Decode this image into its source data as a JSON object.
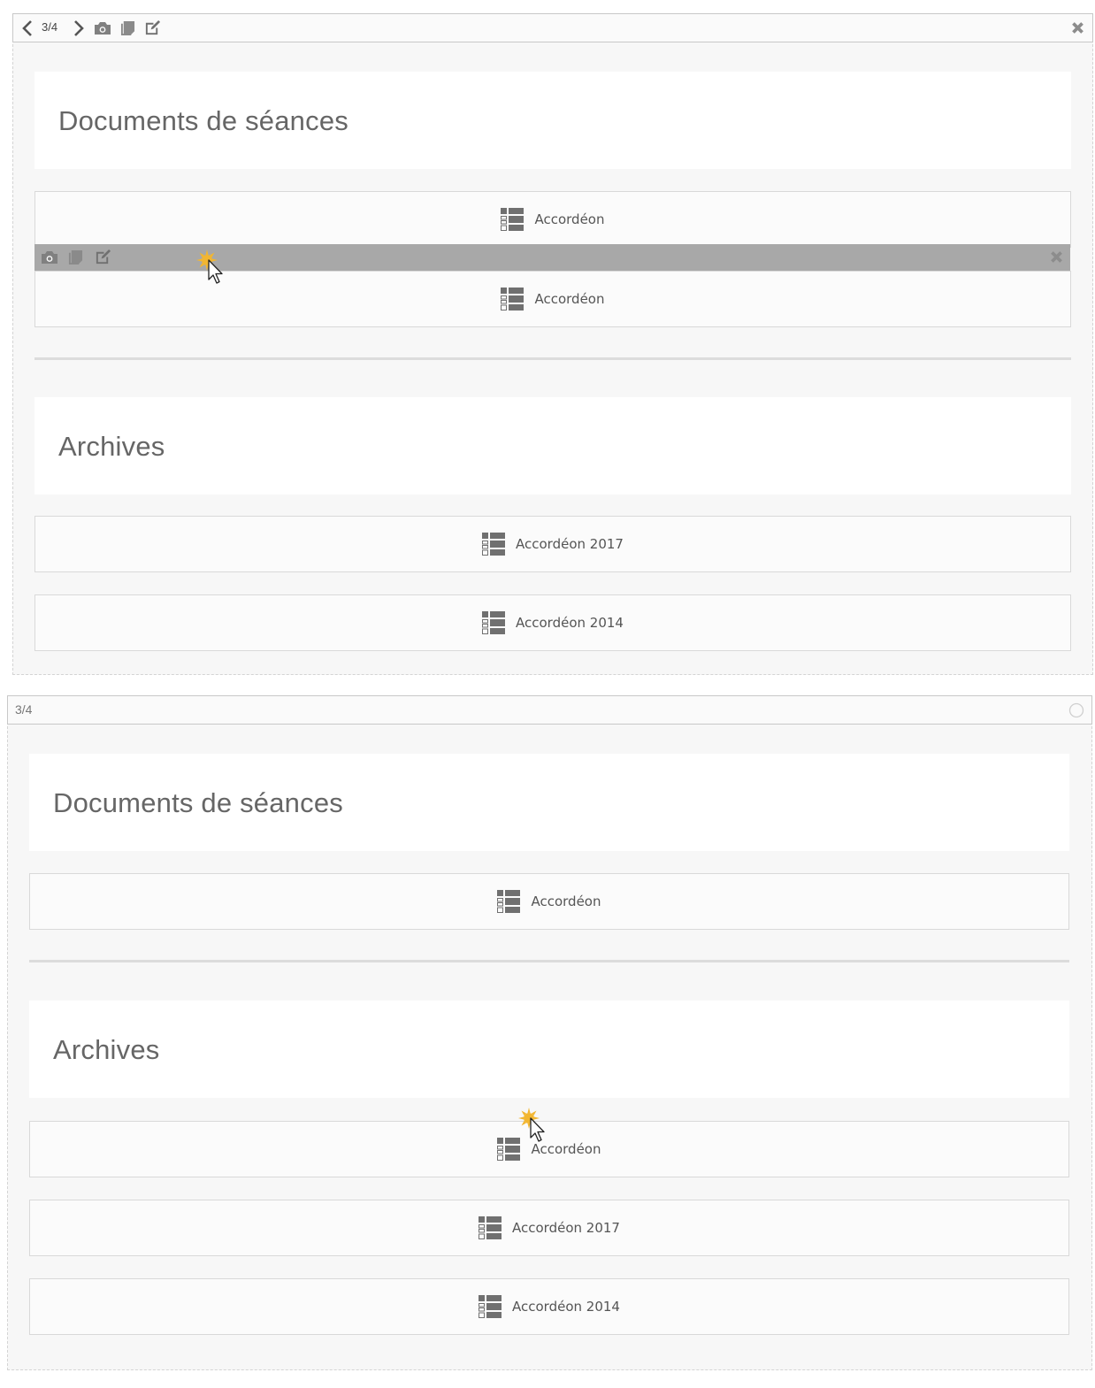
{
  "panel1": {
    "pager": "3/4",
    "heading1": "Documents de séances",
    "accordion_a": "Accordéon",
    "accordion_b": "Accordéon",
    "heading2": "Archives",
    "accordion_2017": "Accordéon 2017",
    "accordion_2014": "Accordéon 2014"
  },
  "panel2": {
    "pager": "3/4",
    "heading1": "Documents de séances",
    "accordion_a": "Accordéon",
    "heading2": "Archives",
    "accordion_b": "Accordéon",
    "accordion_2017": "Accordéon 2017",
    "accordion_2014": "Accordéon 2014"
  },
  "icons": {
    "prev": "chevron-left-icon",
    "next": "chevron-right-icon",
    "camera": "camera-icon",
    "copy": "copy-icon",
    "edit": "edit-icon",
    "close": "close-icon",
    "accordion": "accordion-list-icon",
    "radio": "radio-circle-icon"
  },
  "colors": {
    "toolbar_active": "#a8a8a8",
    "icon": "#707070",
    "panel_bg": "#f7f7f7",
    "cursor_highlight": "#f2b631"
  }
}
